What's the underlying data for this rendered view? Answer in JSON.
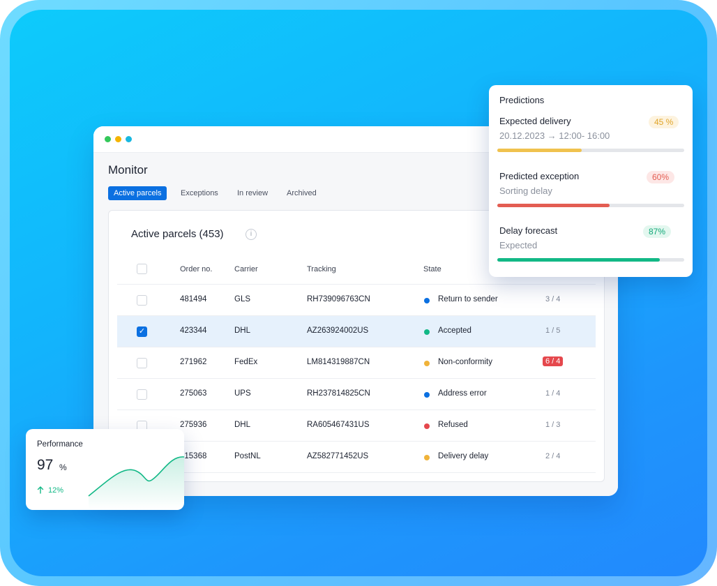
{
  "window": {
    "dots": [
      "#34c85a",
      "#f5b400",
      "#17b8e0"
    ],
    "title": "Monitor",
    "tabs": [
      "Active parcels",
      "Exceptions",
      "In review",
      "Archived"
    ]
  },
  "table": {
    "title": "Active parcels (453)",
    "info_icon": "i",
    "headers": {
      "order": "Order no.",
      "carrier": "Carrier",
      "tracking": "Tracking",
      "state": "State"
    },
    "rows": [
      {
        "order": "481494",
        "carrier": "GLS",
        "tracking": "RH739096763CN",
        "state": "Return to sender",
        "state_color": "#0b70e1",
        "count": "3 / 4",
        "checked": false,
        "alert": false
      },
      {
        "order": "423344",
        "carrier": "DHL",
        "tracking": "AZ263924002US",
        "state": "Accepted",
        "state_color": "#12b886",
        "count": "1 / 5",
        "checked": true,
        "alert": false
      },
      {
        "order": "271962",
        "carrier": "FedEx",
        "tracking": "LM814319887CN",
        "state": "Non-conformity",
        "state_color": "#f0b33a",
        "count": "6 / 4",
        "checked": false,
        "alert": true
      },
      {
        "order": "275063",
        "carrier": "UPS",
        "tracking": "RH237814825CN",
        "state": "Address error",
        "state_color": "#0b70e1",
        "count": "1 / 4",
        "checked": false,
        "alert": false
      },
      {
        "order": "275936",
        "carrier": "DHL",
        "tracking": "RA605467431US",
        "state": "Refused",
        "state_color": "#e5484d",
        "count": "1 / 3",
        "checked": false,
        "alert": false
      },
      {
        "order": "415368",
        "carrier": "PostNL",
        "tracking": "AZ582771452US",
        "state": "Delivery delay",
        "state_color": "#f0b33a",
        "count": "2 / 4",
        "checked": false,
        "alert": false
      }
    ]
  },
  "predictions": {
    "title": "Predictions",
    "items": [
      {
        "label": "Expected delivery",
        "sub": "20.12.2023 → 12:00- 16:00",
        "pill": "45 %",
        "value": 0.45,
        "color": "#f0c24e",
        "pill_bg": "#fdf3df",
        "pill_color": "#e0a52a"
      },
      {
        "label": "Predicted exception",
        "sub": "Sorting delay",
        "pill": "60%",
        "value": 0.6,
        "color": "#e35d52",
        "pill_bg": "#fde7e6",
        "pill_color": "#e35d52"
      },
      {
        "label": "Delay forecast",
        "sub": "Expected",
        "pill": "87%",
        "value": 0.87,
        "color": "#12b886",
        "pill_bg": "#e3f7ef",
        "pill_color": "#12a878"
      }
    ]
  },
  "performance": {
    "title": "Performance",
    "value": "97",
    "unit": "%",
    "delta": "12%",
    "delta_icon": "arrow-up-icon",
    "line_color": "#12b886"
  }
}
